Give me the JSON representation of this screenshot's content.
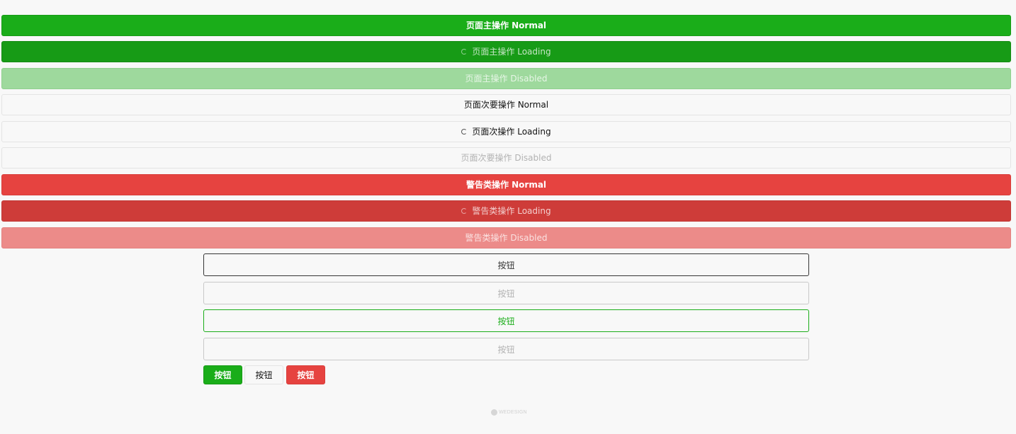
{
  "buttons": {
    "primary_normal": "页面主操作 Normal",
    "primary_loading": "页面主操作 Loading",
    "primary_disabled": "页面主操作 Disabled",
    "default_normal": "页面次要操作 Normal",
    "default_loading": "页面次操作 Loading",
    "default_disabled": "页面次要操作 Disabled",
    "warn_normal": "警告类操作 Normal",
    "warn_loading": "警告类操作 Loading",
    "warn_disabled": "警告类操作 Disabled"
  },
  "plain_buttons": {
    "default": "按钮",
    "default_disabled": "按钮",
    "primary": "按钮",
    "primary_disabled": "按钮"
  },
  "mini_buttons": {
    "primary": "按钮",
    "default": "按钮",
    "warn": "按钮"
  },
  "footer": {
    "logo_text": "WEDESIGN"
  },
  "colors": {
    "primary": "#1aad19",
    "warn": "#e64340",
    "background": "#f8f8f8"
  }
}
